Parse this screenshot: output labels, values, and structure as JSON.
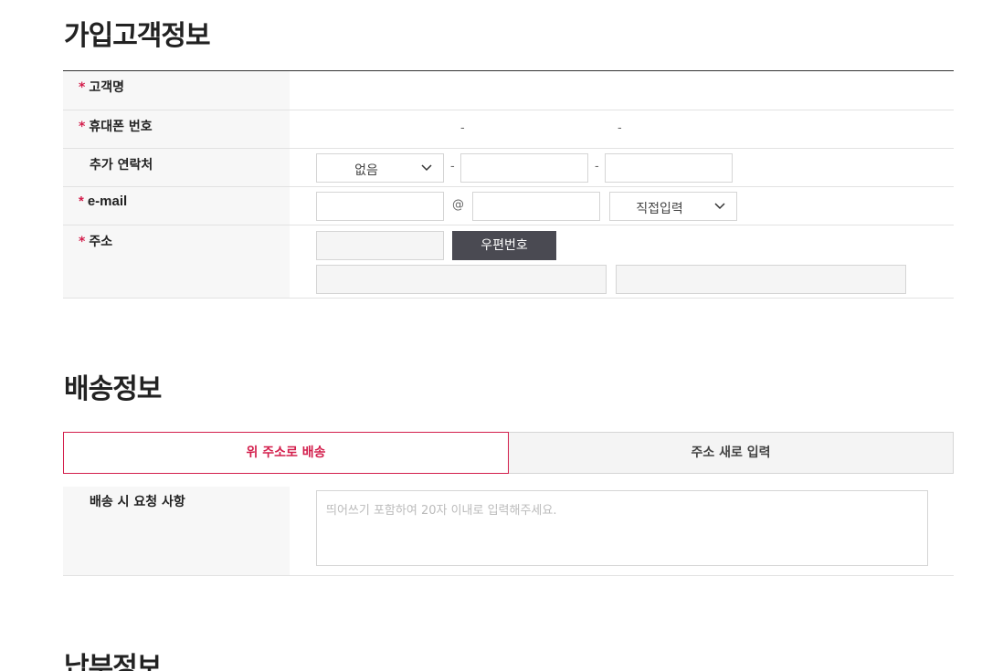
{
  "customer_section": {
    "title": "가입고객정보",
    "name_label": "고객명",
    "phone_label": "휴대폰 번호",
    "phone_sep1": "-",
    "phone_sep2": "-",
    "extra_contact_label": "추가 연락처",
    "extra_contact_select": "없음",
    "extra_sep1": "-",
    "extra_sep2": "-",
    "email_label": "e-mail",
    "email_at": "@",
    "email_domain_select": "직접입력",
    "address_label": "주소",
    "zipcode_button": "우편번호",
    "required_mark": "*"
  },
  "delivery_section": {
    "title": "배송정보",
    "tabs": [
      {
        "label": "위 주소로 배송",
        "active": true
      },
      {
        "label": "주소 새로 입력",
        "active": false
      }
    ],
    "request_label": "배송 시 요청 사항",
    "request_placeholder": "띄어쓰기 포함하여 20자 이내로 입력해주세요."
  },
  "payment_section": {
    "title": "납부정보"
  },
  "colors": {
    "accent": "#d31e4c",
    "button_dark": "#4a4a52",
    "row_header_bg": "#f7f7f7"
  },
  "icons": {
    "select_arrow": "chevron-down-icon"
  }
}
